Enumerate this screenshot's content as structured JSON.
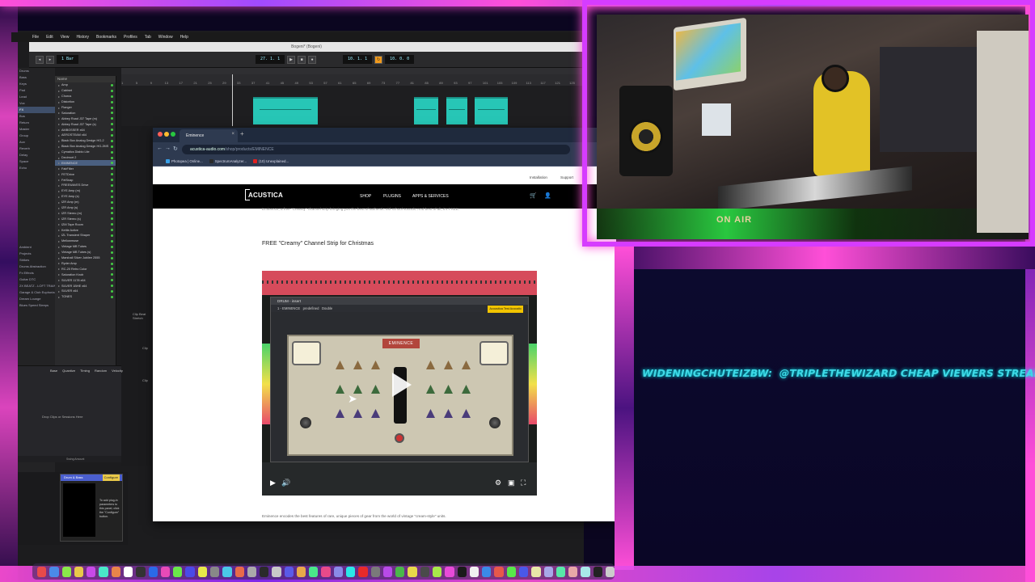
{
  "mac_menu": [
    "File",
    "Edit",
    "View",
    "History",
    "Bookmarks",
    "Profiles",
    "Tab",
    "Window",
    "Help"
  ],
  "daw": {
    "title": "Bogeni* (Bogeni)",
    "toolbar": {
      "position": "27. 1. 1",
      "bars": "4 Bar",
      "tempo": "10. 1. 1",
      "end": "10. 0. 0",
      "loop": "1 Bar"
    },
    "ruler": [
      "1",
      "5",
      "9",
      "13",
      "17",
      "21",
      "25",
      "29",
      "33",
      "37",
      "41",
      "45",
      "49",
      "53",
      "57",
      "61",
      "65",
      "69",
      "73",
      "77",
      "81",
      "85",
      "89",
      "93",
      "97",
      "101",
      "105",
      "109",
      "113",
      "117",
      "121",
      "125"
    ],
    "inspector": [
      "Drums",
      "Bass",
      "Keys",
      "Pad",
      "Lead",
      "Vox",
      "FX",
      "Bus",
      "Return",
      "Master",
      "Group",
      "Aux",
      "Reverb",
      "Delay",
      "Space",
      "Echo"
    ],
    "browser_head": "Name",
    "browser_items": [
      "Amp",
      "Cabinet",
      "Chorus",
      "Distortion",
      "Flanger",
      "Saturation",
      "Abbey Road J37 Tape (m)",
      "Abbey Road J37 Tape (s)",
      "AMBOSSER x64",
      "AEROSTEAM x64",
      "Black Box Analog Design HG-2",
      "Black Box Analog Design HG-2MS",
      "Cymatics Diablo Lite",
      "Decimort 2",
      "EMINENCE",
      "FabFilter",
      "FETDrive",
      "FetSnap",
      "FREEWAVES Drive",
      "EYE Amp (m)",
      "EYE Amp (s)",
      "IZR Amp (m)",
      "IZR Amp (s)",
      "IZR Stereo (m)",
      "IZR Stereo (s)",
      "IZM Tape Room",
      "Kettle Active",
      "IZL Transient Shaper",
      "Mellowmuse",
      "Vintage MB Tubes",
      "Vintage MB Tubes (s)",
      "Marshall Silver Jubilee 2555",
      "Ryder Amp",
      "RC-20 Retro Color",
      "Saturation Knob",
      "SILVER 1178 x64",
      "SILVER 1BHE x64",
      "SILVER x64",
      "TONES"
    ],
    "insp_labels": [
      "Ambient",
      "Projects",
      "Strikes",
      "Drums Abstraction",
      "Fx Effects",
      "Guitar DTC",
      "2X BEATZ - LOFT TRAINS",
      "Garage & Club Euphoria",
      "Dream Lounge",
      "Blues Speed Sleeps"
    ],
    "editor_tabs": [
      "Base",
      "Quantize",
      "Timing",
      "Random",
      "Velocity"
    ],
    "editor_drop": "Drop Clips or Sessions Here",
    "editor_footer": "Swing Amount",
    "track_labels": [
      "Clip Beat Stretch",
      "Clip",
      "Clip"
    ],
    "device_title": "Drum & Bass",
    "device_badge": "Configure",
    "device_note": "To add plug-in parameters to this panel, click the \"Configure\" button.",
    "device_footer": "0 | 0"
  },
  "browser": {
    "tab_title": "Eminence",
    "url_host": "acustica-audio.com",
    "url_path": "/shop/products/EMINENCE",
    "bookmarks": [
      {
        "label": "Photopea | Online...",
        "color": "#39a0e8"
      },
      {
        "label": "SpectrumAnalyzer...",
        "color": "#2a2a2a"
      },
      {
        "label": "(10) Unexplained...",
        "color": "#e02020"
      }
    ],
    "announce": [
      "Installation",
      "Support"
    ],
    "site_logo": "ACUSTICA",
    "nav_links": [
      "SHOP",
      "PLUGINS",
      "APPS & SERVICES"
    ],
    "intro": "Eminence, a free \"Creamy\" channel strip bringing you the best of authentic old-school sounds. And best of all, it's FREE.",
    "heading": "FREE \"Creamy\" Channel Strip for Christmas",
    "footer_text": "Eminence encodes the best features of rare, unique pieces of gear from the world of vintage \"cream-style\" units."
  },
  "video": {
    "window_title": "DRUM - insert",
    "plugin_name": "1 - EMINENCE",
    "preset": "predefined",
    "label_mode": "Double",
    "brand_plate": "EMINENCE",
    "badge": "Acoustica Test Acoustic"
  },
  "webcam": {
    "sign": "ON AIR"
  },
  "chat": {
    "username": "WIDENINGCHUTEIZBW:",
    "message": "@TRIPLETHEWIZARD CHEAP VIEWERS STREAMBOO .COM (R"
  },
  "colors": {
    "neon": "#ff4fd8",
    "clip": "#27c6b6",
    "chat_text": "#3fd8e6"
  }
}
